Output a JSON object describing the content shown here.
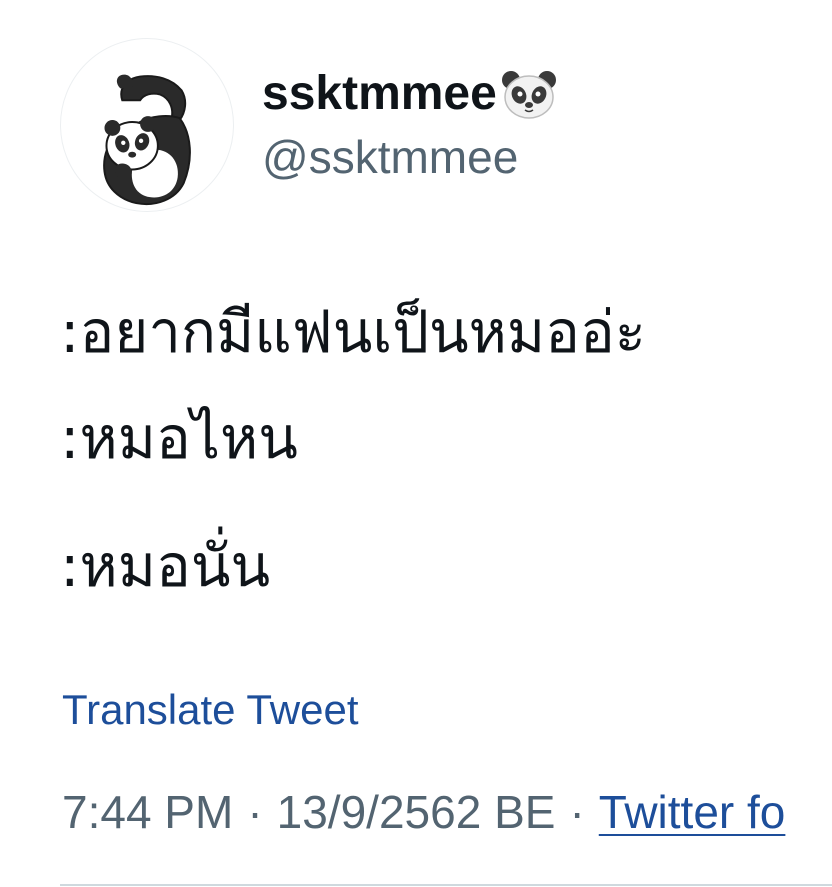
{
  "author": {
    "display_name": "ssktmmee",
    "display_name_emoji": "panda-face-emoji",
    "handle": "@ssktmmee",
    "avatar": "panda-avatar-illustration"
  },
  "tweet": {
    "lines": [
      ":อยากมีแฟนเป็นหมออ่ะ",
      ":หมอไหน",
      ":หมอนั่น"
    ],
    "translate_label": "Translate Tweet",
    "time": "7:44 PM",
    "date": "13/9/2562 BE",
    "separator": "·",
    "source": "Twitter fo"
  },
  "colors": {
    "text": "#0f1419",
    "secondary": "#536471",
    "link": "#1d4e9a",
    "divider": "#cfd9de"
  }
}
